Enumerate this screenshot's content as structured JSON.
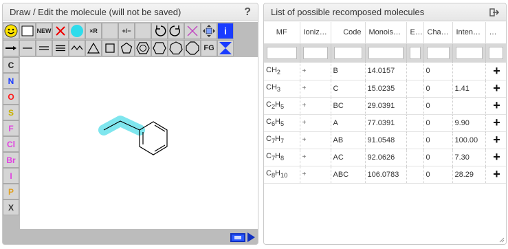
{
  "editor": {
    "title": "Draw / Edit the molecule (will not be saved)",
    "help_label": "?",
    "toolbar": {
      "new_label": "NEW",
      "remove_r_label": "×R",
      "charge_label": "+/−",
      "fg_label": "FG",
      "info_label": "i"
    },
    "atoms": [
      {
        "label": "C",
        "color": "#222222"
      },
      {
        "label": "N",
        "color": "#1f3fff"
      },
      {
        "label": "O",
        "color": "#ff1a1a"
      },
      {
        "label": "S",
        "color": "#c8b000"
      },
      {
        "label": "F",
        "color": "#e040e0"
      },
      {
        "label": "Cl",
        "color": "#e040e0"
      },
      {
        "label": "Br",
        "color": "#e040e0"
      },
      {
        "label": "I",
        "color": "#e040e0"
      },
      {
        "label": "P",
        "color": "#e0a020"
      },
      {
        "label": "X",
        "color": "#333333"
      }
    ],
    "highlight_color": "#7fe6ee"
  },
  "results": {
    "title": "List of possible recomposed molecules",
    "columns": [
      "MF",
      "Ioniz…",
      "Code",
      "Monois…",
      "E…",
      "Cha…",
      "Inten…",
      "…"
    ],
    "rows": [
      {
        "mf": "CH",
        "mf_sub": "2",
        "ion": "+",
        "code": "B",
        "mono": "14.0157",
        "charge": "0",
        "intensity": "",
        "add": "+"
      },
      {
        "mf": "CH",
        "mf_sub": "3",
        "ion": "+",
        "code": "C",
        "mono": "15.0235",
        "charge": "0",
        "intensity": "1.41",
        "add": "+"
      },
      {
        "mf": "C2H",
        "mf_sub": "5",
        "ion": "+",
        "code": "BC",
        "mono": "29.0391",
        "charge": "0",
        "intensity": "",
        "add": "+"
      },
      {
        "mf": "C6H",
        "mf_sub": "5",
        "ion": "+",
        "code": "A",
        "mono": "77.0391",
        "charge": "0",
        "intensity": "9.90",
        "add": "+"
      },
      {
        "mf": "C7H",
        "mf_sub": "7",
        "ion": "+",
        "code": "AB",
        "mono": "91.0548",
        "charge": "0",
        "intensity": "100.00",
        "add": "+"
      },
      {
        "mf": "C7H",
        "mf_sub": "8",
        "ion": "+",
        "code": "AC",
        "mono": "92.0626",
        "charge": "0",
        "intensity": "7.30",
        "add": "+"
      },
      {
        "mf": "C8H",
        "mf_sub": "10",
        "ion": "+",
        "code": "ABC",
        "mono": "106.0783",
        "charge": "0",
        "intensity": "28.29",
        "add": "+"
      }
    ]
  }
}
